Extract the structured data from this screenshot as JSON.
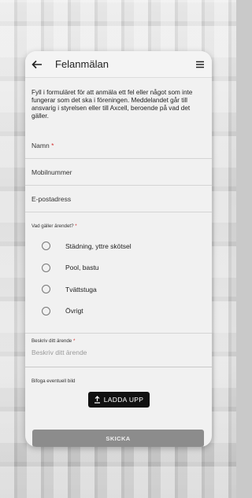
{
  "appbar": {
    "title": "Felanmälan"
  },
  "intro": "Fyll i formuläret för att anmäla ett fel eller något som inte fungerar som det ska i föreningen. Meddelandet går till ansvarig i styrelsen eller till Axcell, beroende på vad det gäller.",
  "fields": {
    "name_label": "Namn",
    "name_required": "*",
    "phone_label": "Mobilnummer",
    "email_label": "E-postadress"
  },
  "question": {
    "label": "Vad gäller ärendet?",
    "required": "*"
  },
  "options": [
    "Städning, yttre skötsel",
    "Pool, bastu",
    "Tvättstuga",
    "Övrigt"
  ],
  "description": {
    "label": "Beskriv ditt ärende",
    "required": "*",
    "placeholder": "Beskriv ditt ärende"
  },
  "attachment": {
    "label": "Bifoga eventuell bild",
    "button": "LADDA UPP"
  },
  "submit": "SKICKA"
}
